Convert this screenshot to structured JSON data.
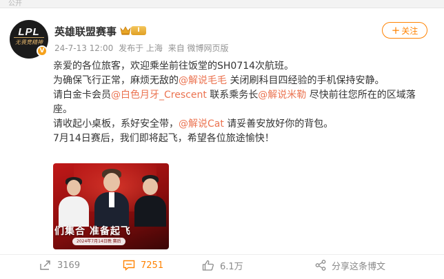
{
  "top_bar": {
    "text": "公开"
  },
  "account": {
    "avatar_text": "LPL",
    "avatar_subtext": "无畏竞精神",
    "verified_mark": "V",
    "name": "英雄联盟赛事",
    "level": "I"
  },
  "meta": {
    "timestamp": "24-7-13 12:00",
    "location": "发布于 上海",
    "source": "来自 微博网页版"
  },
  "follow_button": {
    "label": "关注"
  },
  "post": {
    "line1": "亲爱的各位旅客，欢迎乘坐前往饭堂的SH0714次航班。",
    "line2_pre": "为确保飞行正常，麻烦无敌的",
    "mention1": "@解说毛毛",
    "line2_post": " 关闭刷科目四经验的手机保持安静。",
    "line3_pre": "请白金卡会员",
    "mention2": "@白色月牙_Crescent",
    "line3_mid": " 联系乘务长",
    "mention3": "@解说米勒",
    "line3_post": " 尽快前往您所在的区域落座。",
    "line4_pre": "请收起小桌板，系好安全带，",
    "mention4": "@解说Cat",
    "line4_post": " 请妥善安放好你的背包。",
    "line5": "7月14日赛后，我们即将起飞，希望各位旅途愉快！"
  },
  "image": {
    "headline": "们集合  准备起飞",
    "date_text": "2024年7月14日晚 赛后"
  },
  "actions": {
    "repost_count": "3169",
    "comment_count": "7251",
    "like_count": "6.1万",
    "share_label": "分享这条博文"
  },
  "colors": {
    "accent": "#ff8200",
    "mention": "#eb7350",
    "meta_text": "#939393",
    "image_red": "#c01818"
  },
  "icons": {
    "crown": "crown-icon",
    "repost": "repost-icon",
    "comment": "comment-icon",
    "like": "thumbs-up-icon",
    "share": "share-icon"
  }
}
